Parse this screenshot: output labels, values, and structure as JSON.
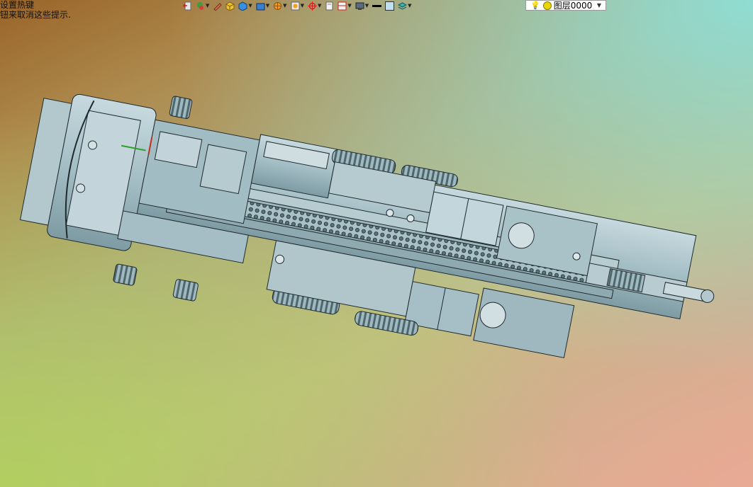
{
  "hint": {
    "line1": "设置热键",
    "line2": "钮来取消这些提示."
  },
  "toolbar": {
    "icons": [
      "exit-icon",
      "layers-icon",
      "edit-icon",
      "box-icon",
      "cube-icon",
      "view-icon",
      "sun-icon",
      "render-icon",
      "target-icon",
      "page-icon",
      "frame-icon",
      "monitor-icon",
      "line-color-icon",
      "fill-color-icon",
      "stack-icon"
    ]
  },
  "layer": {
    "name": "图层0000"
  },
  "colors": {
    "model_fill": "#a9c2c8",
    "model_stroke": "#1f2a2e",
    "model_dark": "#6f8a92"
  }
}
